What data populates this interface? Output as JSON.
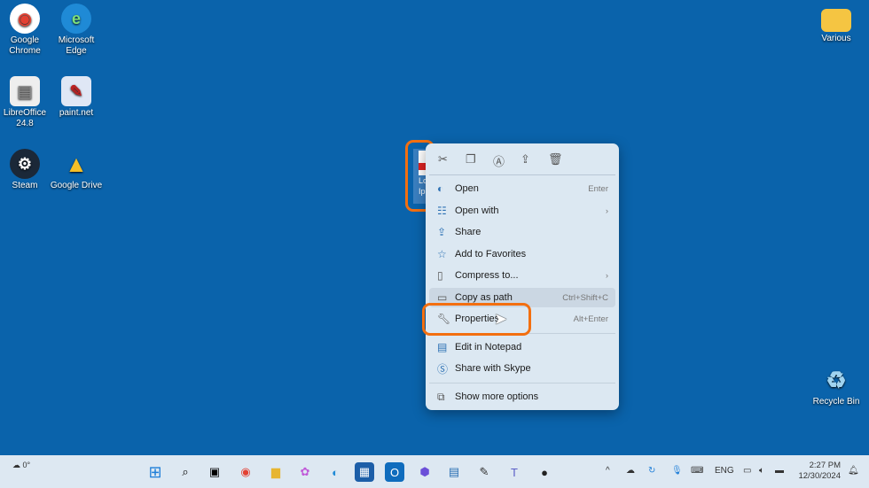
{
  "desktop": {
    "icons": [
      {
        "label": "Google Chrome",
        "glyph": "◉",
        "color": "#e34133"
      },
      {
        "label": "Microsoft Edge",
        "glyph": "e",
        "color": "#1f8ad6"
      },
      {
        "label": "LibreOffice 24.8",
        "glyph": "▤",
        "color": "#e8e8e8"
      },
      {
        "label": "paint.net",
        "glyph": "✎",
        "color": "#dfe7f5"
      },
      {
        "label": "Steam",
        "glyph": "⚙",
        "color": "#1b2838"
      },
      {
        "label": "Google Drive",
        "glyph": "▲",
        "color": "#f6bf26"
      },
      {
        "label": "Various",
        "glyph": "▬",
        "color": "#f5c542"
      },
      {
        "label": "Recycle Bin",
        "glyph": "♻",
        "color": "#9fd3f0"
      }
    ],
    "selected_file": {
      "label": "Lo Ipsu"
    }
  },
  "context_menu": {
    "toolbar": [
      "cut-icon",
      "copy-icon",
      "rename-icon",
      "share-icon",
      "delete-icon"
    ],
    "items": [
      {
        "label": "Open",
        "shortcut": "Enter",
        "icon": "edge-icon"
      },
      {
        "label": "Open with",
        "shortcut": "›",
        "icon": "open-with-icon"
      },
      {
        "label": "Share",
        "shortcut": "",
        "icon": "share-icon"
      },
      {
        "label": "Add to Favorites",
        "shortcut": "",
        "icon": "star-icon"
      },
      {
        "label": "Compress to...",
        "shortcut": "›",
        "icon": "zip-icon"
      },
      {
        "label": "Copy as path",
        "shortcut": "Ctrl+Shift+C",
        "icon": "path-icon"
      },
      {
        "label": "Properties",
        "shortcut": "Alt+Enter",
        "icon": "wrench-icon"
      },
      {
        "label": "Edit in Notepad",
        "shortcut": "",
        "icon": "notepad-icon"
      },
      {
        "label": "Share with Skype",
        "shortcut": "",
        "icon": "skype-icon"
      },
      {
        "label": "Show more options",
        "shortcut": "",
        "icon": "more-options-icon"
      }
    ]
  },
  "taskbar": {
    "weather": "0°",
    "language": "ENG",
    "time": "2:27 PM",
    "date": "12/30/2024"
  },
  "colors": {
    "highlight": "#f36f10",
    "desktop": "#0a63ab"
  }
}
